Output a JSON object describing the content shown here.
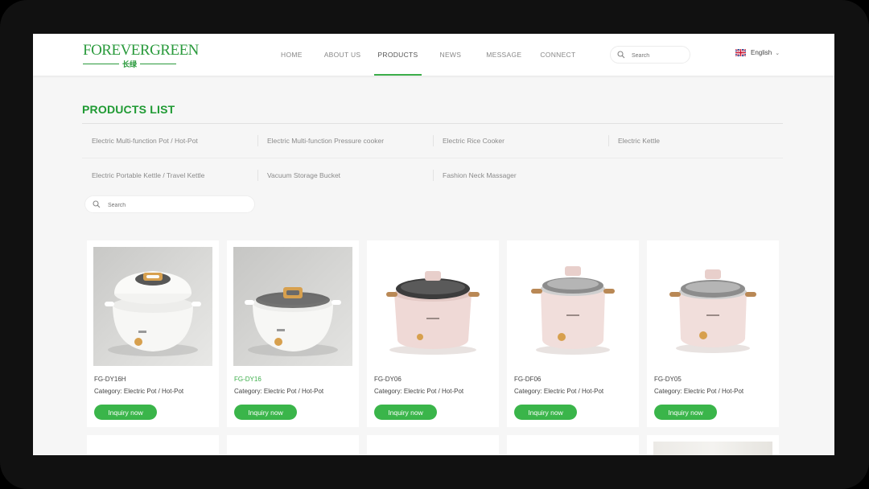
{
  "brand": {
    "name": "FOREVERGREEN",
    "name_cn": "长绿"
  },
  "nav": [
    {
      "label": "HOME",
      "active": false
    },
    {
      "label": "ABOUT US",
      "active": false
    },
    {
      "label": "PRODUCTS",
      "active": true
    },
    {
      "label": "NEWS",
      "active": false
    },
    {
      "label": "MESSAGE",
      "active": false
    },
    {
      "label": "CONNECT",
      "active": false
    }
  ],
  "header_search": {
    "placeholder": "Search"
  },
  "language": {
    "label": "English"
  },
  "page": {
    "title": "PRODUCTS LIST"
  },
  "categories": [
    "Electric Multi-function Pot / Hot-Pot",
    "Electric Multi-function Pressure cooker",
    "Electric Rice Cooker",
    "Electric Kettle",
    "Electric Portable Kettle / Travel Kettle",
    "Vacuum Storage Bucket",
    "Fashion Neck Massager"
  ],
  "list_search": {
    "placeholder": "Search"
  },
  "products": [
    {
      "model": "FG-DY16H",
      "category": "Category:   Electric Pot / Hot-Pot",
      "button": "Inquiry now",
      "color": "white",
      "highlighted": false
    },
    {
      "model": "FG-DY16",
      "category": "Category:   Electric Pot / Hot-Pot",
      "button": "Inquiry now",
      "color": "white",
      "highlighted": true
    },
    {
      "model": "FG-DY06",
      "category": "Category:   Electric Pot / Hot-Pot",
      "button": "Inquiry now",
      "color": "pink",
      "highlighted": false
    },
    {
      "model": "FG-DF06",
      "category": "Category:   Electric Pot / Hot-Pot",
      "button": "Inquiry now",
      "color": "pink",
      "highlighted": false
    },
    {
      "model": "FG-DY05",
      "category": "Category:   Electric Pot / Hot-Pot",
      "button": "Inquiry now",
      "color": "pink",
      "highlighted": false
    }
  ],
  "colors": {
    "accent": "#3ab54a",
    "title": "#1f9a33",
    "brand": "#2a9a3c"
  }
}
